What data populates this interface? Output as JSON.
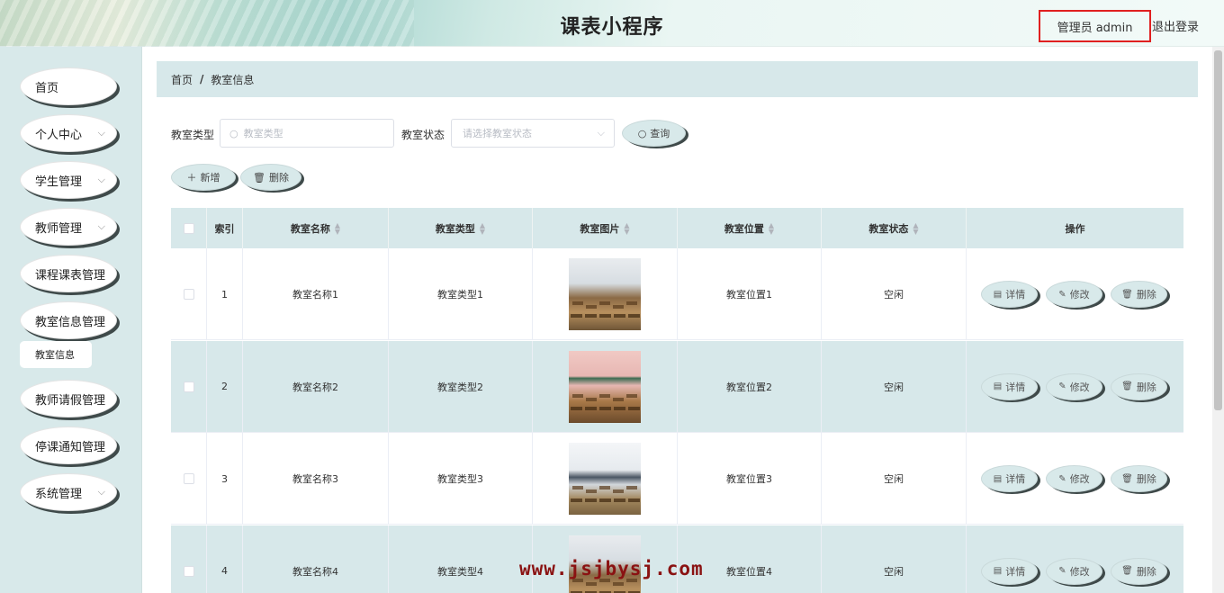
{
  "header": {
    "title": "课表小程序",
    "admin_label": "管理员 admin",
    "logout_label": "退出登录"
  },
  "sidebar": {
    "items": [
      {
        "label": "首页",
        "has_arrow": false
      },
      {
        "label": "个人中心",
        "has_arrow": true
      },
      {
        "label": "学生管理",
        "has_arrow": true
      },
      {
        "label": "教师管理",
        "has_arrow": true
      },
      {
        "label": "课程课表管理",
        "has_arrow": false
      },
      {
        "label": "教室信息管理",
        "has_arrow": false
      },
      {
        "label": "教师请假管理",
        "has_arrow": false
      },
      {
        "label": "停课通知管理",
        "has_arrow": false
      },
      {
        "label": "系统管理",
        "has_arrow": true
      }
    ],
    "sub_item": "教室信息"
  },
  "breadcrumb": {
    "home": "首页",
    "separator": "/",
    "current": "教室信息"
  },
  "search": {
    "type_label": "教室类型",
    "type_placeholder": "教室类型",
    "status_label": "教室状态",
    "status_placeholder": "请选择教室状态",
    "query_button": "查询"
  },
  "actions": {
    "add_button": "新增",
    "delete_button": "删除"
  },
  "table": {
    "columns": [
      "索引",
      "教室名称",
      "教室类型",
      "教室图片",
      "教室位置",
      "教室状态",
      "操作"
    ],
    "row_actions": {
      "detail": "详情",
      "edit": "修改",
      "delete": "删除"
    },
    "rows": [
      {
        "index": "1",
        "name": "教室名称1",
        "type": "教室类型1",
        "location": "教室位置1",
        "status": "空闲"
      },
      {
        "index": "2",
        "name": "教室名称2",
        "type": "教室类型2",
        "location": "教室位置2",
        "status": "空闲"
      },
      {
        "index": "3",
        "name": "教室名称3",
        "type": "教室类型3",
        "location": "教室位置3",
        "status": "空闲"
      },
      {
        "index": "4",
        "name": "教室名称4",
        "type": "教室类型4",
        "location": "教室位置4",
        "status": "空闲"
      }
    ]
  },
  "watermark": "www.jsjbysj.com",
  "colors": {
    "accent_bg": "#d7e8ea",
    "button_shadow": "#3f4a4a",
    "highlight_border": "#e02020",
    "watermark": "#8a1212"
  }
}
